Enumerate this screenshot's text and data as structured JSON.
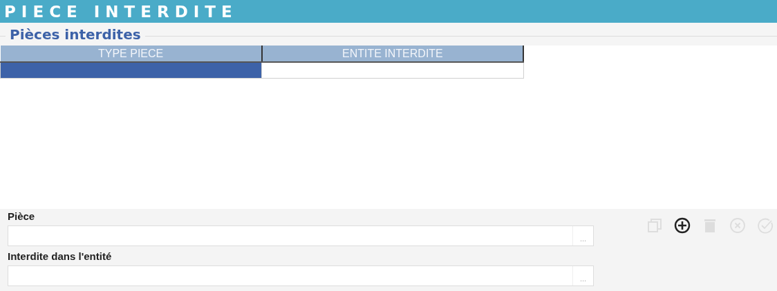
{
  "window": {
    "title": "PIECE INTERDITE"
  },
  "section": {
    "title": "Pièces interdites"
  },
  "table": {
    "columns": [
      "TYPE PIECE",
      "ENTITE INTERDITE"
    ],
    "rows": [
      {
        "selected": true
      }
    ]
  },
  "form": {
    "fields": [
      {
        "label": "Pièce",
        "browse": "..."
      },
      {
        "label": "Interdite dans l'entité",
        "browse": "..."
      }
    ]
  },
  "toolbar": [
    {
      "kind": "copy",
      "disabled": true
    },
    {
      "kind": "add",
      "disabled": false
    },
    {
      "kind": "delete",
      "disabled": true
    },
    {
      "kind": "cancel",
      "disabled": true
    },
    {
      "kind": "validate",
      "disabled": true
    }
  ]
}
